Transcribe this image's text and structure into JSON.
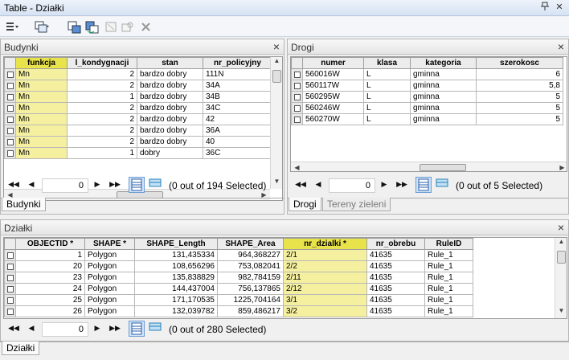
{
  "window": {
    "title": "Table - Działki",
    "pin_glyph": "📌",
    "close_glyph": "✕"
  },
  "toolbar": {
    "icons": [
      "table-options-icon",
      "related-tables-icon",
      "select-by-attributes-icon",
      "switch-selection-icon",
      "clear-selection-icon",
      "zoom-to-selected-icon",
      "delete-selected-icon"
    ]
  },
  "budynki": {
    "title": "Budynki",
    "close_glyph": "×",
    "columns": [
      "funkcja",
      "l_kondygnacji",
      "stan",
      "nr_policyjny"
    ],
    "rows": [
      [
        "Mn",
        "2",
        "bardzo dobry",
        "111N"
      ],
      [
        "Mn",
        "2",
        "bardzo dobry",
        "34A"
      ],
      [
        "Mn",
        "1",
        "bardzo dobry",
        "34B"
      ],
      [
        "Mn",
        "2",
        "bardzo dobry",
        "34C"
      ],
      [
        "Mn",
        "2",
        "bardzo dobry",
        "42"
      ],
      [
        "Mn",
        "2",
        "bardzo dobry",
        "36A"
      ],
      [
        "Mn",
        "2",
        "bardzo dobry",
        "40"
      ],
      [
        "Mn",
        "1",
        "dobry",
        "36C"
      ]
    ],
    "record": "0",
    "selected_text": "(0 out of 194 Selected)",
    "tabs": [
      "Budynki"
    ]
  },
  "drogi": {
    "title": "Drogi",
    "close_glyph": "×",
    "columns": [
      "numer",
      "klasa",
      "kategoria",
      "szerokosc"
    ],
    "rows": [
      [
        "560016W",
        "L",
        "gminna",
        "6"
      ],
      [
        "560117W",
        "L",
        "gminna",
        "5,8"
      ],
      [
        "560295W",
        "L",
        "gminna",
        "5"
      ],
      [
        "560246W",
        "L",
        "gminna",
        "5"
      ],
      [
        "560270W",
        "L",
        "gminna",
        "5"
      ]
    ],
    "record": "0",
    "selected_text": "(0 out of 5 Selected)",
    "tabs": [
      "Drogi",
      "Tereny zieleni"
    ]
  },
  "dzialki": {
    "title": "Działki",
    "close_glyph": "×",
    "columns": [
      "OBJECTID *",
      "SHAPE *",
      "SHAPE_Length",
      "SHAPE_Area",
      "nr_dzialki *",
      "nr_obrebu",
      "RuleID"
    ],
    "rows": [
      [
        "1",
        "Polygon",
        "131,435334",
        "964,368227",
        "2/1",
        "41635",
        "Rule_1"
      ],
      [
        "20",
        "Polygon",
        "108,656296",
        "753,082041",
        "2/2",
        "41635",
        "Rule_1"
      ],
      [
        "23",
        "Polygon",
        "135,838829",
        "982,784159",
        "2/11",
        "41635",
        "Rule_1"
      ],
      [
        "24",
        "Polygon",
        "144,437004",
        "756,137865",
        "2/12",
        "41635",
        "Rule_1"
      ],
      [
        "25",
        "Polygon",
        "171,170535",
        "1225,704164",
        "3/1",
        "41635",
        "Rule_1"
      ],
      [
        "26",
        "Polygon",
        "132,039782",
        "859,486217",
        "3/2",
        "41635",
        "Rule_1"
      ]
    ],
    "record": "0",
    "selected_text": "(0 out of 280 Selected)",
    "tabs": [
      "Działki"
    ]
  },
  "nav": {
    "first": "◀◀",
    "prev": "◀",
    "next": "▶",
    "last": "▶▶"
  }
}
